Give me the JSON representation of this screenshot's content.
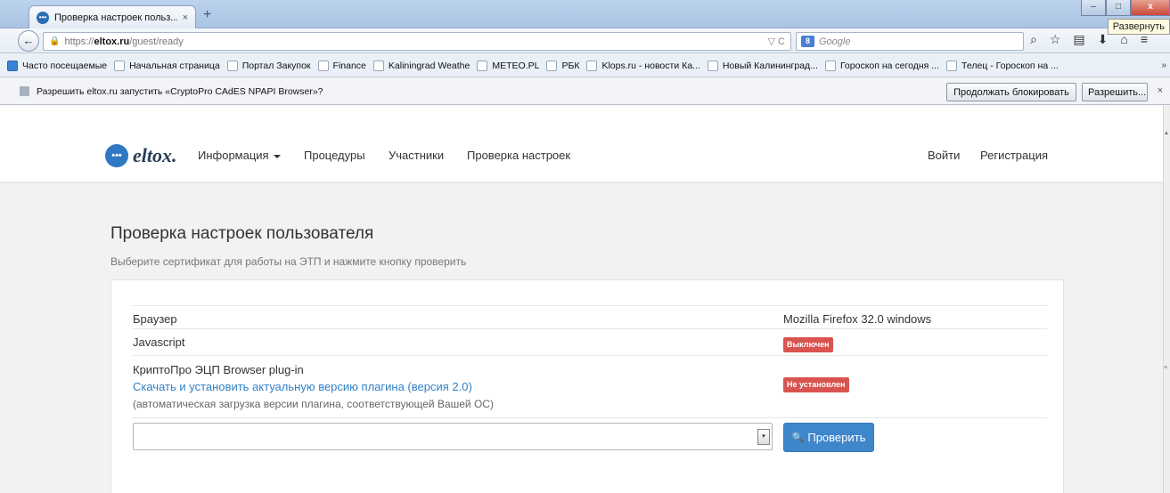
{
  "window": {
    "tab_title": "Проверка настроек польз...",
    "tab_close": "×",
    "new_tab": "+",
    "tooltip": "Развернуть",
    "btn_minimize": "–",
    "btn_maximize": "□",
    "btn_close": "x"
  },
  "navbar": {
    "back": "←",
    "url_host": "https://",
    "url_domain": "eltox.ru",
    "url_path": "/guest/ready",
    "reload": "▽ C",
    "search_engine": "8",
    "search_placeholder": "Google",
    "icons": [
      "⌕",
      "☆",
      "▤",
      "⬇",
      "⌂",
      "≡"
    ]
  },
  "bookmarks": [
    "Часто посещаемые",
    "Начальная страница",
    "Портал Закупок",
    "Finance",
    "Kaliningrad Weathe",
    "METEO.PL",
    "РБК",
    "Klops.ru - новости Ка...",
    "Новый Калининград...",
    "Гороскоп на сегодня ...",
    "Телец - Гороскоп на ..."
  ],
  "bookmarks_more": "»",
  "notification": {
    "text": "Разрешить eltox.ru запустить «CryptoPro CAdES NPAPI Browser»?",
    "continue_block": "Продолжать блокировать",
    "allow": "Разрешить...",
    "close": "×"
  },
  "site": {
    "logo_mark": "•••",
    "logo_text": "eltox.",
    "nav_info": "Информация",
    "nav_procedures": "Процедуры",
    "nav_participants": "Участники",
    "nav_check": "Проверка настроек",
    "nav_login": "Войти",
    "nav_register": "Регистрация"
  },
  "main": {
    "title": "Проверка настроек пользователя",
    "subtitle": "Выберите сертификат для работы на ЭТП и нажмите кнопку проверить",
    "rows": [
      {
        "label": "Браузер",
        "value": "Mozilla Firefox 32.0 windows"
      },
      {
        "label": "Javascript",
        "status": "Выключен"
      },
      {
        "label": "КриптоПро ЭЦП Browser plug-in",
        "link": "Скачать и установить актуальную версию плагина (версия 2.0)",
        "note": "(автоматическая загрузка версии плагина, соответствующей Вашей ОС)",
        "status": "Не установлен"
      }
    ],
    "select_arrow": "▾",
    "check_button": "Проверить",
    "check_icon": "🔍"
  },
  "colors": {
    "accent": "#3f87cb",
    "link": "#2f80c7",
    "danger": "#d9534f"
  }
}
